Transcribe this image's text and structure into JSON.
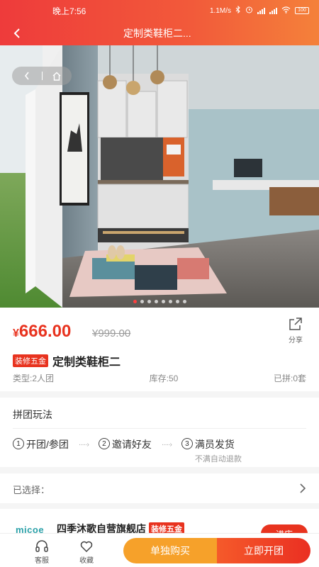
{
  "status_bar": {
    "time": "晚上7:56",
    "speed": "1.1M/s",
    "battery": "100"
  },
  "header": {
    "title": "定制类鞋柜二..."
  },
  "colors": {
    "accent": "#e8331f",
    "single_button": "#f6a12a"
  },
  "product": {
    "currency": "¥",
    "price": "666.00",
    "old_price": "¥999.00",
    "share_label": "分享",
    "tag": "装修五金",
    "name": "定制类鞋柜二",
    "type": "类型:2人团",
    "stock": "库存:50",
    "joined": "已拼:0套"
  },
  "group": {
    "title": "拼团玩法",
    "steps": [
      {
        "num": "1",
        "label": "开团/参团"
      },
      {
        "num": "2",
        "label": "邀请好友"
      },
      {
        "num": "3",
        "label": "满员发货",
        "sub": "不满自动退款"
      }
    ]
  },
  "selected": {
    "label": "已选择："
  },
  "store": {
    "logo": "micoe",
    "name": "四季沐歌自营旗舰店",
    "tag": "装修五金",
    "enter": "进店"
  },
  "bottom": {
    "service": "客服",
    "favorite": "收藏",
    "buy_single": "单独购买",
    "start_group": "立即开团"
  },
  "icons": [
    "back-icon",
    "home-icon",
    "share-icon",
    "chevron-right-icon",
    "headset-icon",
    "heart-icon",
    "wifi-icon",
    "bluetooth-icon",
    "alarm-icon"
  ]
}
